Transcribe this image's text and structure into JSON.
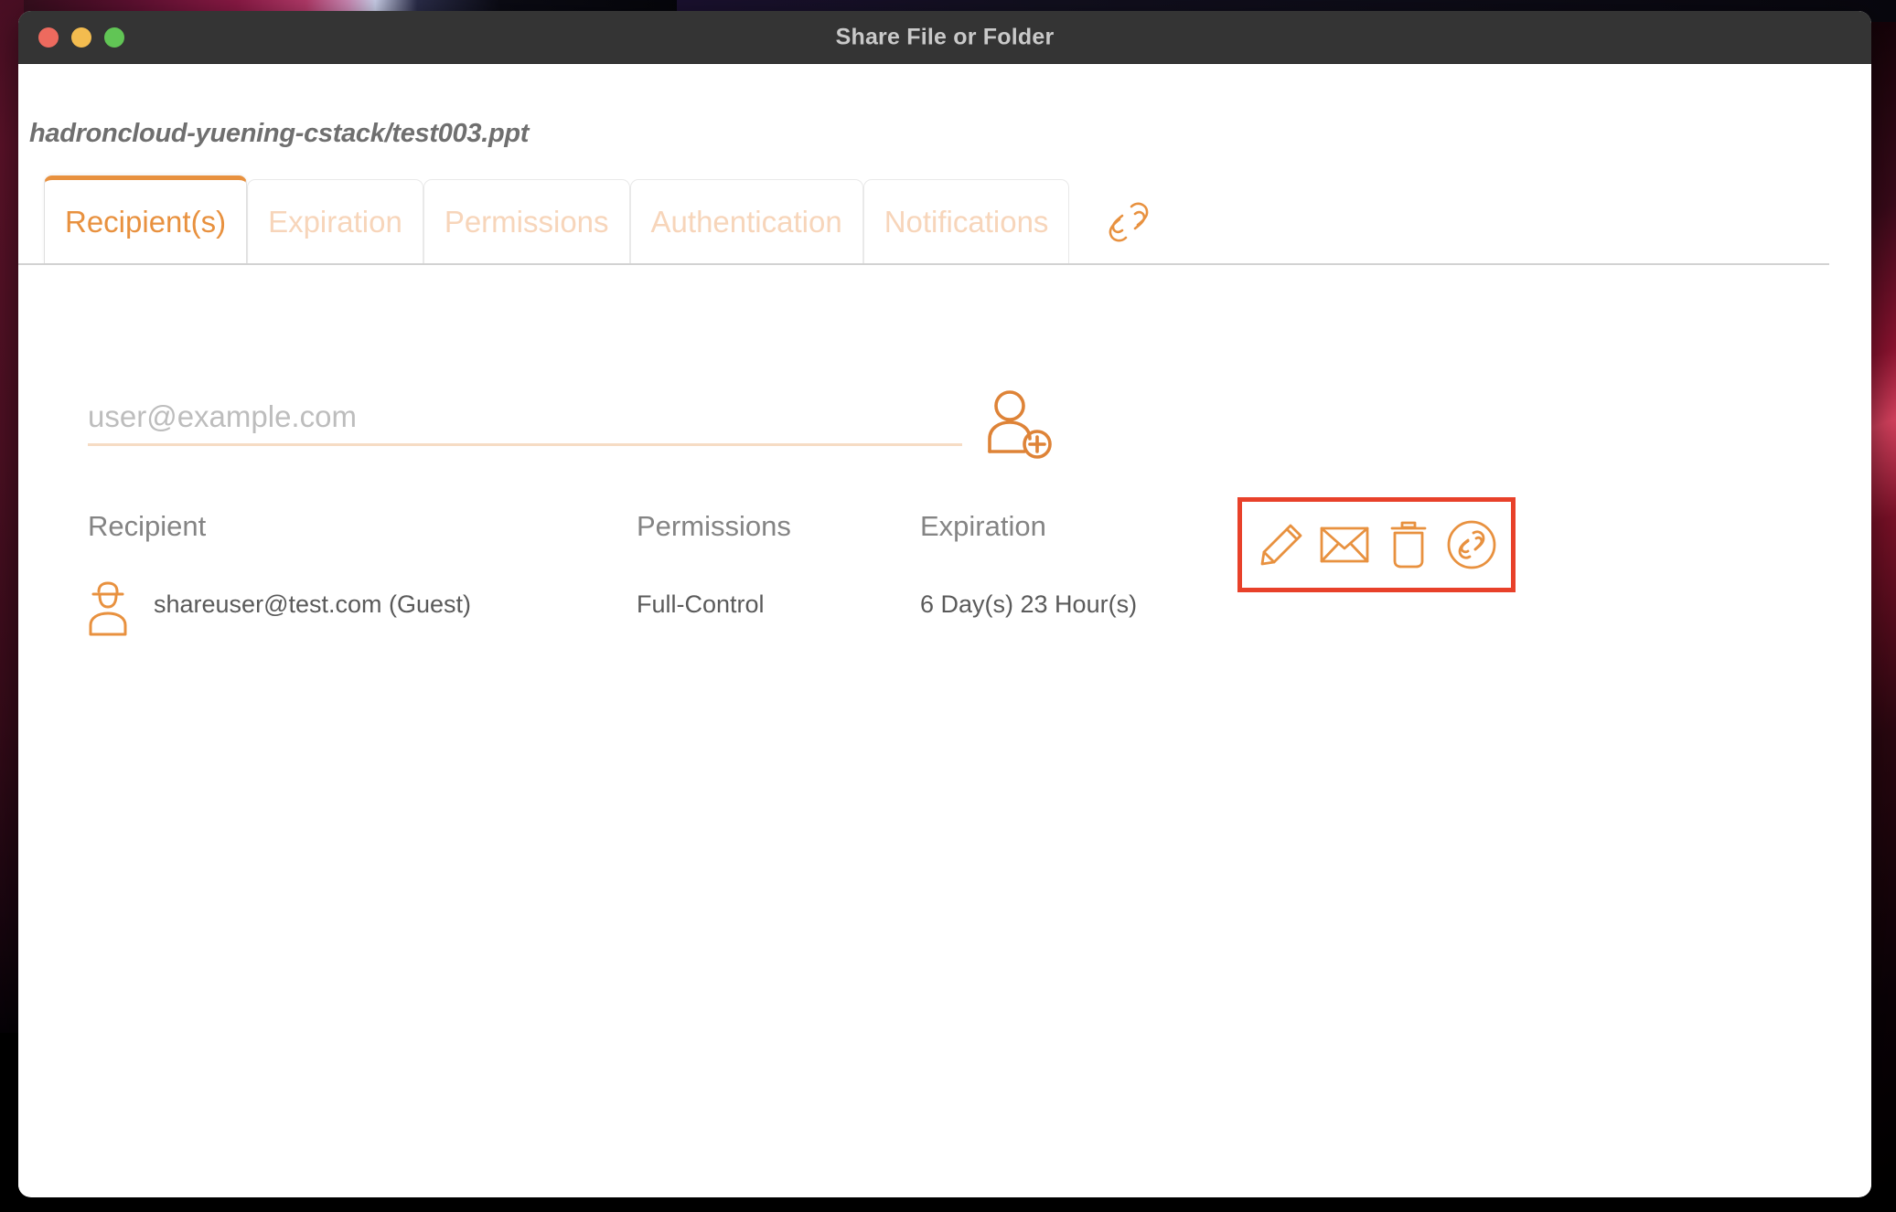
{
  "window": {
    "title": "Share File or Folder",
    "traffic_lights": [
      {
        "name": "close",
        "color": "#ED6A5E"
      },
      {
        "name": "minimize",
        "color": "#F3BC4F"
      },
      {
        "name": "zoom",
        "color": "#61C555"
      }
    ]
  },
  "filepath": "hadroncloud-yuening-cstack/test003.ppt",
  "tabs": [
    {
      "label": "Recipient(s)",
      "active": true
    },
    {
      "label": "Expiration",
      "active": false
    },
    {
      "label": "Permissions",
      "active": false
    },
    {
      "label": "Authentication",
      "active": false
    },
    {
      "label": "Notifications",
      "active": false
    }
  ],
  "tab_extra_icon": "link-icon",
  "recipient_input": {
    "value": "",
    "placeholder": "user@example.com"
  },
  "add_user_icon": "add-user-icon",
  "table": {
    "headers": {
      "recipient": "Recipient",
      "permissions": "Permissions",
      "expiration": "Expiration"
    },
    "rows": [
      {
        "icon": "guest-user-icon",
        "recipient": "shareuser@test.com (Guest)",
        "permissions": "Full-Control",
        "expiration": "6 Day(s) 23 Hour(s)"
      }
    ]
  },
  "actions": [
    {
      "name": "edit-button",
      "icon": "pencil-icon"
    },
    {
      "name": "email-button",
      "icon": "envelope-icon"
    },
    {
      "name": "delete-button",
      "icon": "trash-icon"
    },
    {
      "name": "copy-link-button",
      "icon": "link-circle-icon"
    }
  ],
  "colors": {
    "accent": "#E8913F",
    "accent_muted": "#F7D5BA",
    "highlight_box": "#E8412A",
    "titlebar": "#343434",
    "title_text": "#C9C9C9"
  }
}
